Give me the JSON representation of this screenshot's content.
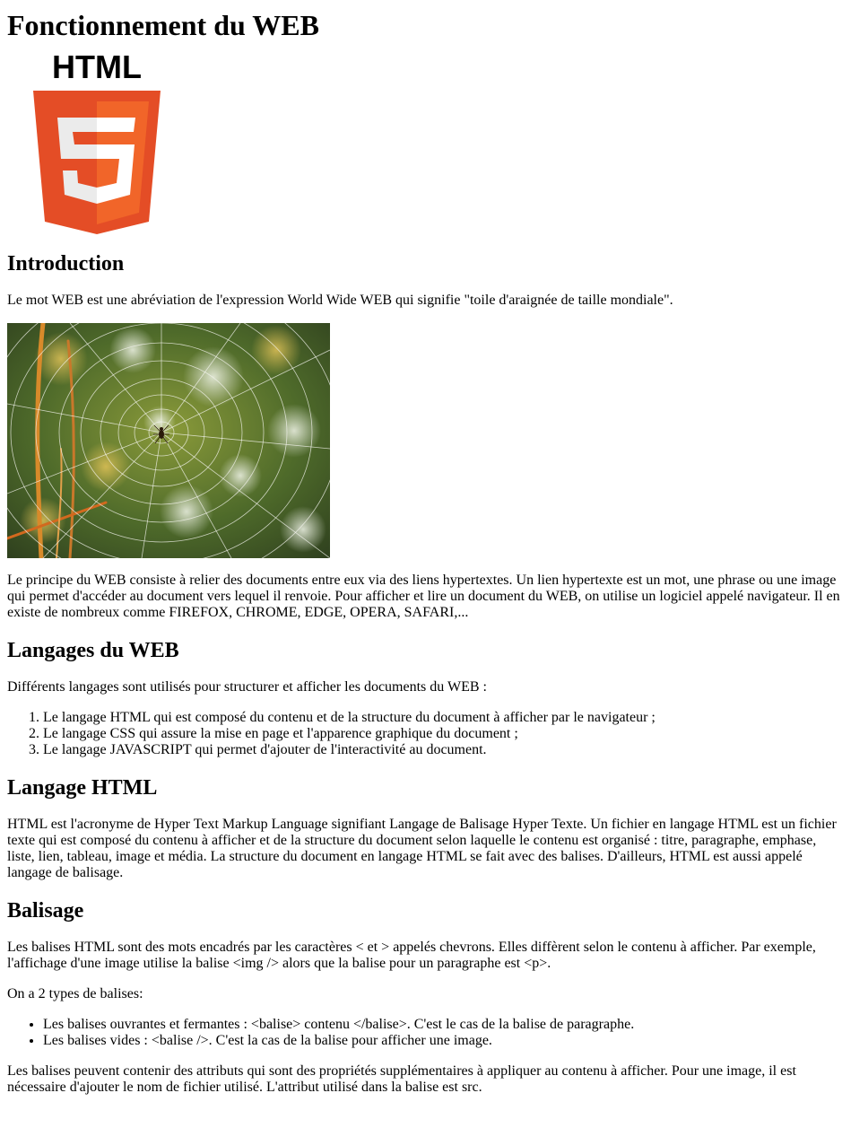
{
  "title": "Fonctionnement du WEB",
  "logo": {
    "text": "HTML",
    "digit": "5",
    "colors": {
      "dark": "#e44d26",
      "light": "#f16529",
      "shield_text": "#ebebeb",
      "white": "#ffffff"
    }
  },
  "sections": {
    "introduction": {
      "heading": "Introduction",
      "p1": "Le mot WEB est une abréviation de l'expression World Wide WEB qui signifie \"toile d'araignée de taille mondiale\".",
      "p2": "Le principe du WEB consiste à relier des documents entre eux via des liens hypertextes. Un lien hypertexte est un mot, une phrase ou une image qui permet d'accéder au document vers lequel il renvoie. Pour afficher et lire un document du WEB, on utilise un logiciel appelé navigateur. Il en existe de nombreux comme FIREFOX, CHROME, EDGE, OPERA, SAFARI,..."
    },
    "langages": {
      "heading": "Langages du WEB",
      "intro": "Différents langages sont utilisés pour structurer et afficher les documents du WEB :",
      "items": [
        "Le langage HTML qui est composé du contenu et de la structure du document à afficher par le navigateur ;",
        "Le langage CSS qui assure la mise en page et l'apparence graphique du document ;",
        "Le langage JAVASCRIPT qui permet d'ajouter de l'interactivité au document."
      ]
    },
    "html": {
      "heading": "Langage HTML",
      "p1": "HTML est l'acronyme de Hyper Text Markup Language signifiant Langage de Balisage Hyper Texte. Un fichier en langage HTML est un fichier texte qui est composé du contenu à afficher et de la structure du document selon laquelle le contenu est organisé : titre, paragraphe, emphase, liste, lien, tableau, image et média. La structure du document en langage HTML se fait avec des balises. D'ailleurs, HTML est aussi appelé langage de balisage."
    },
    "balisage": {
      "heading": "Balisage",
      "p1": "Les balises HTML sont des mots encadrés par les caractères < et > appelés chevrons. Elles diffèrent selon le contenu à afficher. Par exemple, l'affichage d'une image utilise la balise <img /> alors que la balise pour un paragraphe est <p>.",
      "p2": "On a 2 types de balises:",
      "items": [
        "Les balises ouvrantes et fermantes : <balise> contenu </balise>. C'est le cas de la balise de paragraphe.",
        "Les balises vides : <balise />. C'est la cas de la balise pour afficher une image."
      ],
      "p3": "Les balises peuvent contenir des attributs qui sont des propriétés supplémentaires à appliquer au contenu à afficher. Pour une image, il est nécessaire d'ajouter le nom de fichier utilisé. L'attribut utilisé dans la balise est src."
    }
  }
}
